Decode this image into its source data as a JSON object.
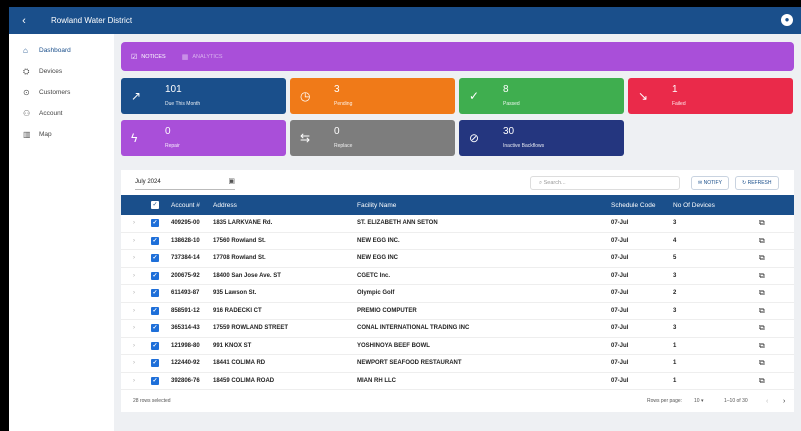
{
  "app": {
    "title": "Rowland Water District",
    "back_icon": "back-arrow-icon",
    "account_icon": "account-circle-icon"
  },
  "sidebar": {
    "items": [
      {
        "label": "Dashboard",
        "icon": "home-icon",
        "glyph": "⌂",
        "active": true
      },
      {
        "label": "Devices",
        "icon": "devices-icon",
        "glyph": "⛭",
        "active": false
      },
      {
        "label": "Customers",
        "icon": "customers-icon",
        "glyph": "⊙",
        "active": false
      },
      {
        "label": "Account",
        "icon": "account-icon",
        "glyph": "⚇",
        "active": false
      },
      {
        "label": "Map",
        "icon": "map-icon",
        "glyph": "▥",
        "active": false
      }
    ]
  },
  "tabs": [
    {
      "label": "NOTICES",
      "icon": "notices-icon",
      "glyph": "☑",
      "active": true
    },
    {
      "label": "ANALYTICS",
      "icon": "analytics-icon",
      "glyph": "▦",
      "active": false
    }
  ],
  "cards": [
    {
      "value": "101",
      "label": "Due This Month",
      "color": "#1a4f8b",
      "glyph": "↗",
      "icon": "trending-up-icon"
    },
    {
      "value": "3",
      "label": "Pending",
      "color": "#f07a18",
      "glyph": "◷",
      "icon": "clock-icon"
    },
    {
      "value": "8",
      "label": "Passed",
      "color": "#3fae4f",
      "glyph": "✓",
      "icon": "check-icon"
    },
    {
      "value": "1",
      "label": "Failed",
      "color": "#ea2a4a",
      "glyph": "↘",
      "icon": "trending-down-icon"
    },
    {
      "value": "0",
      "label": "Repair",
      "color": "#a94fd9",
      "glyph": "ϟ",
      "icon": "repair-icon"
    },
    {
      "value": "0",
      "label": "Replace",
      "color": "#7d7d7d",
      "glyph": "⇆",
      "icon": "replace-icon"
    },
    {
      "value": "30",
      "label": "Inactive Backflows",
      "color": "#24367f",
      "glyph": "⊘",
      "icon": "block-icon"
    }
  ],
  "toolbar": {
    "date_value": "July 2024",
    "calendar_icon": "calendar-icon",
    "search_placeholder": "Search...",
    "search_icon": "search-icon",
    "notify_label": "NOTIFY",
    "refresh_label": "REFRESH"
  },
  "table": {
    "headers": [
      "Account #",
      "Address",
      "Facility Name",
      "Schedule Code",
      "No Of Devices"
    ],
    "rows": [
      {
        "account": "409295-00",
        "address": "1835 LARKVANE Rd.",
        "facility": "ST. ELIZABETH ANN SETON",
        "schedule": "07-Jul",
        "devices": "3"
      },
      {
        "account": "138628-10",
        "address": "17560 Rowland St.",
        "facility": "NEW EGG INC.",
        "schedule": "07-Jul",
        "devices": "4"
      },
      {
        "account": "737384-14",
        "address": "17708 Rowland St.",
        "facility": "NEW EGG INC",
        "schedule": "07-Jul",
        "devices": "5"
      },
      {
        "account": "200675-92",
        "address": "18400 San Jose Ave. ST",
        "facility": "CGETC Inc.",
        "schedule": "07-Jul",
        "devices": "3"
      },
      {
        "account": "611493-87",
        "address": "935 Lawson St.",
        "facility": "Olympic Golf",
        "schedule": "07-Jul",
        "devices": "2"
      },
      {
        "account": "858591-12",
        "address": "916 RADECKI CT",
        "facility": "PREMIO COMPUTER",
        "schedule": "07-Jul",
        "devices": "3"
      },
      {
        "account": "365314-43",
        "address": "17559 ROWLAND STREET",
        "facility": "CONAL INTERNATIONAL TRADING INC",
        "schedule": "07-Jul",
        "devices": "3"
      },
      {
        "account": "121998-80",
        "address": "991 KNOX ST",
        "facility": "YOSHINOYA BEEF BOWL",
        "schedule": "07-Jul",
        "devices": "1"
      },
      {
        "account": "122440-92",
        "address": "18441 COLIMA RD",
        "facility": "NEWPORT SEAFOOD RESTAURANT",
        "schedule": "07-Jul",
        "devices": "1"
      },
      {
        "account": "392806-76",
        "address": "18459 COLIMA ROAD",
        "facility": "MIAN RH LLC",
        "schedule": "07-Jul",
        "devices": "1"
      }
    ],
    "footer": {
      "selected": "28 rows selected",
      "rows_per_page_label": "Rows per page:",
      "rows_per_page": "10",
      "range": "1–10 of 30"
    }
  }
}
